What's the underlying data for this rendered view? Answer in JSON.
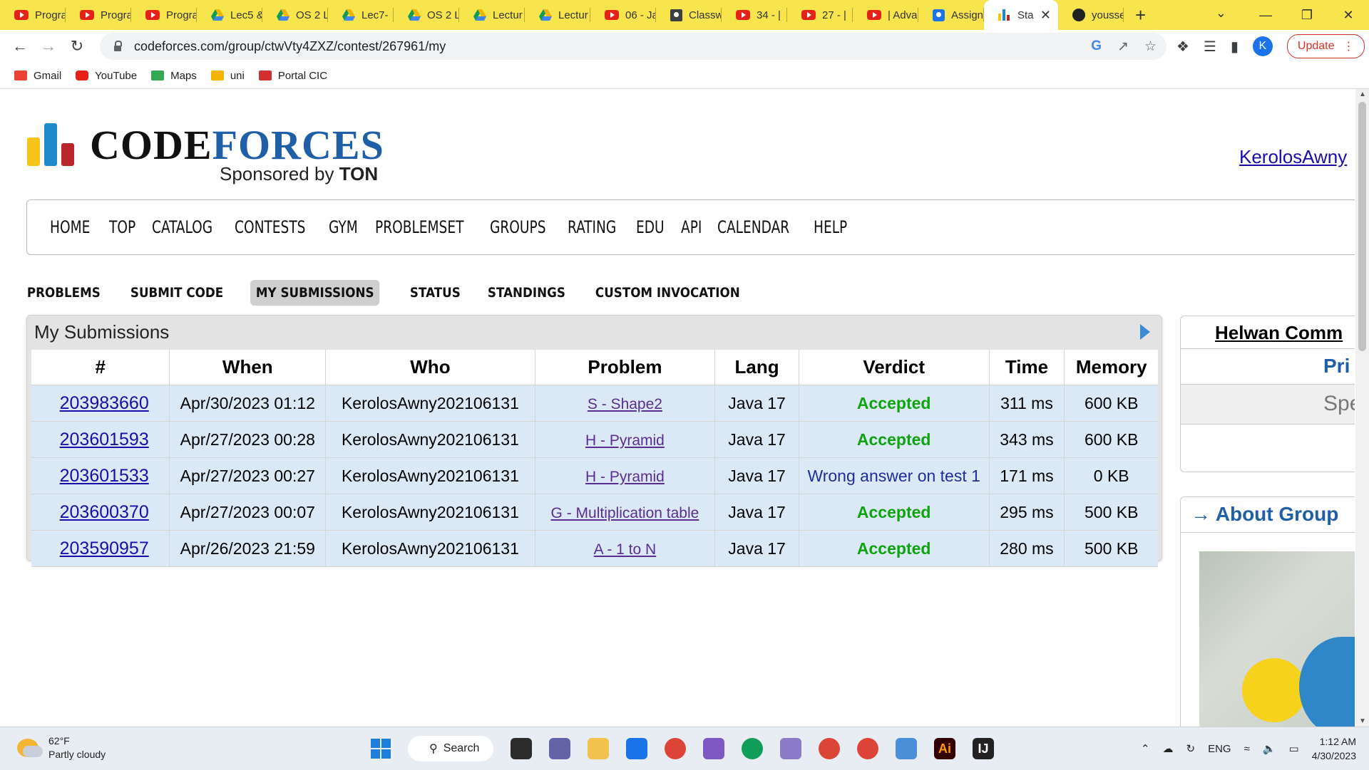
{
  "browser": {
    "tabs": [
      {
        "favicon": "youtube-icon",
        "label": "Progra"
      },
      {
        "favicon": "youtube-icon",
        "label": "Progra"
      },
      {
        "favicon": "youtube-icon",
        "label": "Progra"
      },
      {
        "favicon": "drive-icon",
        "label": "Lec5 &"
      },
      {
        "favicon": "drive-icon",
        "label": "OS 2 L"
      },
      {
        "favicon": "drive-icon",
        "label": "Lec7- "
      },
      {
        "favicon": "drive-icon",
        "label": "OS 2 L"
      },
      {
        "favicon": "drive-icon",
        "label": "Lectur"
      },
      {
        "favicon": "drive-icon",
        "label": "Lectur"
      },
      {
        "favicon": "youtube-icon",
        "label": "06 - Ja"
      },
      {
        "favicon": "classroom-icon",
        "label": "Classw"
      },
      {
        "favicon": "youtube-icon",
        "label": "34 - | "
      },
      {
        "favicon": "youtube-icon",
        "label": "27 - | "
      },
      {
        "favicon": "youtube-icon",
        "label": "| Adva"
      },
      {
        "favicon": "assignment-icon",
        "label": "Assign"
      },
      {
        "favicon": "codeforces-icon",
        "label": "Sta",
        "active": true
      },
      {
        "favicon": "github-icon",
        "label": "yousse"
      }
    ],
    "url": "codeforces.com/group/ctwVty4ZXZ/contest/267961/my",
    "profile_initial": "K",
    "update_label": "Update",
    "bookmarks": [
      {
        "icon": "gmail-icon",
        "label": "Gmail"
      },
      {
        "icon": "youtube-icon",
        "label": "YouTube"
      },
      {
        "icon": "maps-icon",
        "label": "Maps"
      },
      {
        "icon": "folder-icon",
        "label": "uni"
      },
      {
        "icon": "maple-leaf-icon",
        "label": "Portal CIC"
      }
    ]
  },
  "site": {
    "logo_part1": "CODE",
    "logo_part2": "FORCES",
    "sponsor_prefix": "Sponsored by",
    "sponsor_name": "TON",
    "username": "KerolosAwny",
    "colors": {
      "yellow": "#f5c518",
      "blue": "#1f8acb",
      "red": "#b8262b",
      "brand_blue": "#1f5fa8"
    }
  },
  "main_menu": [
    "HOME",
    "TOP",
    "CATALOG",
    "CONTESTS",
    "GYM",
    "PROBLEMSET",
    "GROUPS",
    "RATING",
    "EDU",
    "API",
    "CALENDAR",
    "HELP"
  ],
  "sub_menu": {
    "items": [
      "PROBLEMS",
      "SUBMIT CODE",
      "MY SUBMISSIONS",
      "STATUS",
      "STANDINGS",
      "CUSTOM INVOCATION"
    ],
    "active": "MY SUBMISSIONS"
  },
  "submissions": {
    "title": "My Submissions",
    "columns": [
      "#",
      "When",
      "Who",
      "Problem",
      "Lang",
      "Verdict",
      "Time",
      "Memory"
    ],
    "rows": [
      {
        "id": "203983660",
        "when": "Apr/30/2023 01:12",
        "who": "KerolosAwny202106131",
        "problem": "S - Shape2",
        "lang": "Java 17",
        "verdict": "Accepted",
        "ok": true,
        "time": "311 ms",
        "memory": "600 KB"
      },
      {
        "id": "203601593",
        "when": "Apr/27/2023 00:28",
        "who": "KerolosAwny202106131",
        "problem": "H - Pyramid",
        "lang": "Java 17",
        "verdict": "Accepted",
        "ok": true,
        "time": "343 ms",
        "memory": "600 KB"
      },
      {
        "id": "203601533",
        "when": "Apr/27/2023 00:27",
        "who": "KerolosAwny202106131",
        "problem": "H - Pyramid",
        "lang": "Java 17",
        "verdict": "Wrong answer on test 1",
        "ok": false,
        "time": "171 ms",
        "memory": "0 KB"
      },
      {
        "id": "203600370",
        "when": "Apr/27/2023 00:07",
        "who": "KerolosAwny202106131",
        "problem": "G - Multiplication table",
        "lang": "Java 17",
        "verdict": "Accepted",
        "ok": true,
        "time": "295 ms",
        "memory": "500 KB"
      },
      {
        "id": "203590957",
        "when": "Apr/26/2023 21:59",
        "who": "KerolosAwny202106131",
        "problem": "A - 1 to N",
        "lang": "Java 17",
        "verdict": "Accepted",
        "ok": true,
        "time": "280 ms",
        "memory": "500 KB"
      }
    ]
  },
  "sidebar": {
    "group_title": "Helwan Comm",
    "row2": "Pri",
    "row3": "Spe",
    "about_title": "→ About Group"
  },
  "taskbar": {
    "temperature": "62°F",
    "weather": "Partly cloudy",
    "search_label": "Search",
    "language": "ENG",
    "time": "1:12 AM",
    "date": "4/30/2023"
  }
}
